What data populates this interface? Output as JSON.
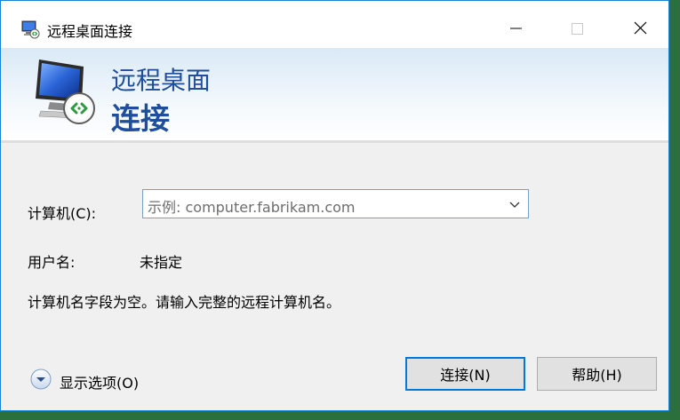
{
  "window": {
    "title": "远程桌面连接"
  },
  "header": {
    "line1": "远程桌面",
    "line2": "连接"
  },
  "form": {
    "computer_label": "计算机(C):",
    "computer_placeholder": "示例: computer.fabrikam.com",
    "user_label": "用户名:",
    "user_value": "未指定",
    "status_message": "计算机名字段为空。请输入完整的远程计算机名。"
  },
  "footer": {
    "show_options_label": "显示选项(O)",
    "connect_label": "连接(N)",
    "help_label": "帮助(H)"
  },
  "colors": {
    "accent": "#0078d7",
    "brand_text": "#1f4e9c",
    "window_border": "#1883d7"
  },
  "icons": {
    "title": "remote-desktop-icon",
    "logo": "remote-desktop-logo",
    "minimize": "minimize-icon",
    "maximize": "maximize-icon",
    "close": "close-icon",
    "dropdown": "chevron-down-icon",
    "options": "expand-options-icon"
  }
}
